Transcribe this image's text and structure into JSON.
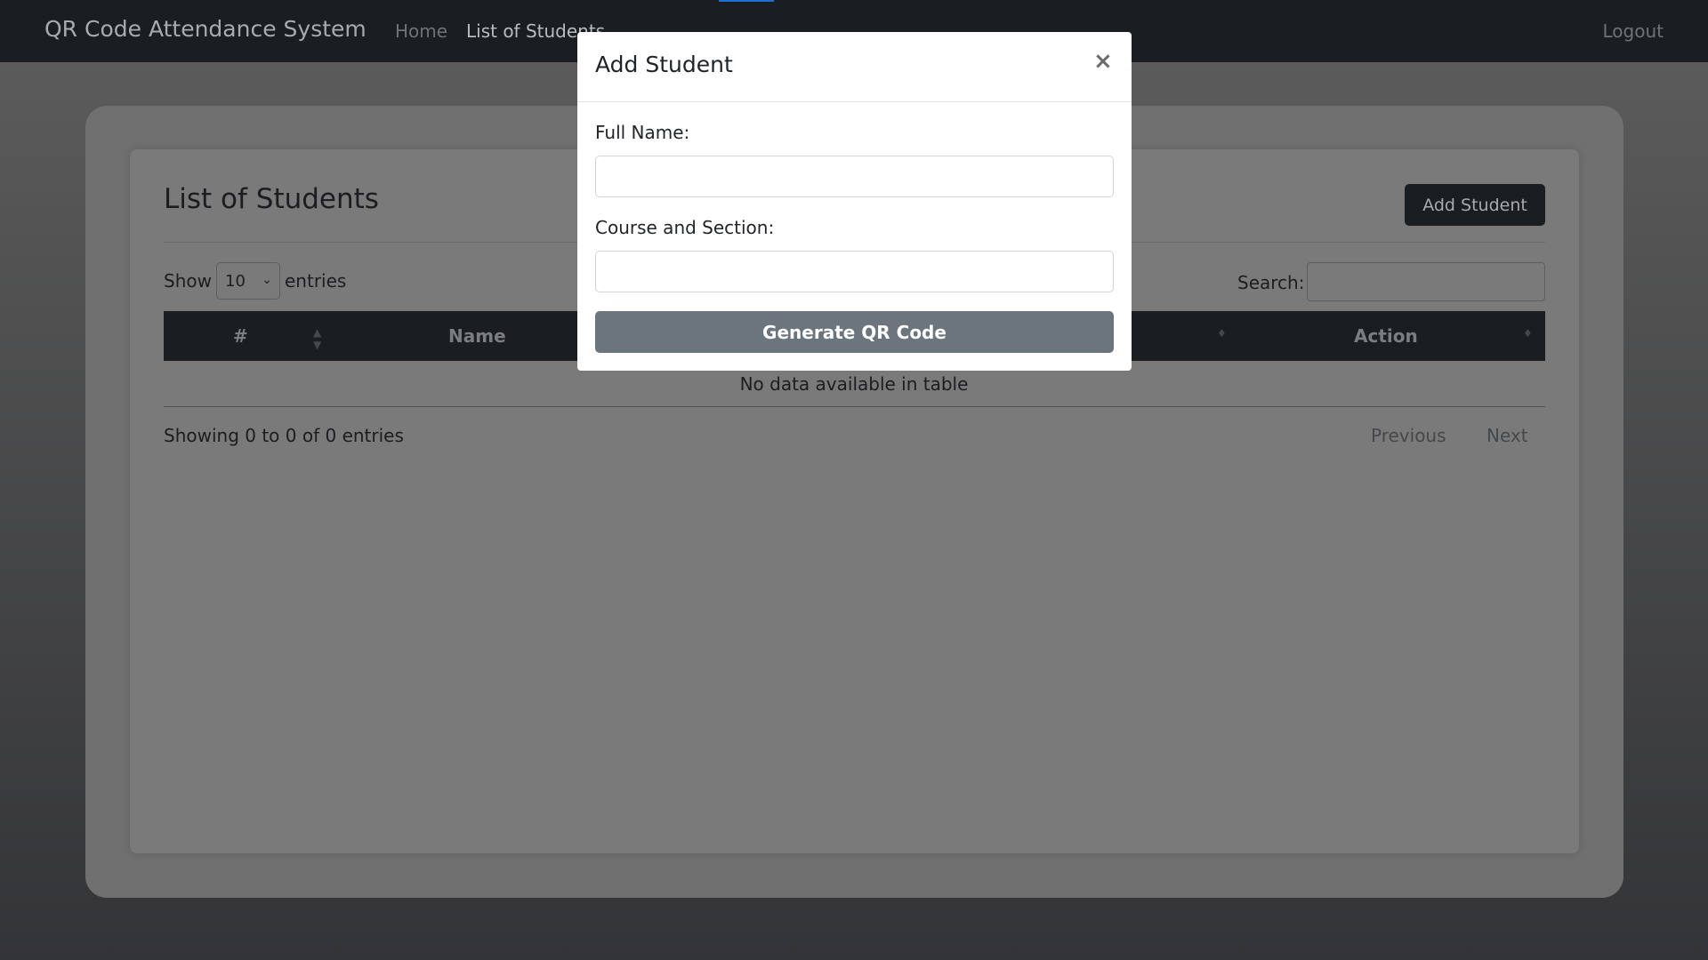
{
  "navbar": {
    "brand": "QR Code Attendance System",
    "links": [
      "Home",
      "List of Students"
    ],
    "logout": "Logout"
  },
  "page": {
    "title": "List of Students",
    "add_button": "Add Student",
    "show_label": "Show",
    "entries_value": "10",
    "entries_label": "entries",
    "search_label": "Search:",
    "columns": [
      "#",
      "Name",
      "Action"
    ],
    "empty_message": "No data available in table",
    "showing_text": "Showing 0 to 0 of 0 entries",
    "previous": "Previous",
    "next": "Next"
  },
  "modal": {
    "title": "Add Student",
    "close": "×",
    "full_name_label": "Full Name:",
    "full_name_value": "",
    "course_label": "Course and Section:",
    "course_value": "",
    "submit": "Generate QR Code"
  },
  "colors": {
    "navbar": "#1a1e22",
    "modal_button": "#6c757d",
    "overlay": "#555555"
  }
}
